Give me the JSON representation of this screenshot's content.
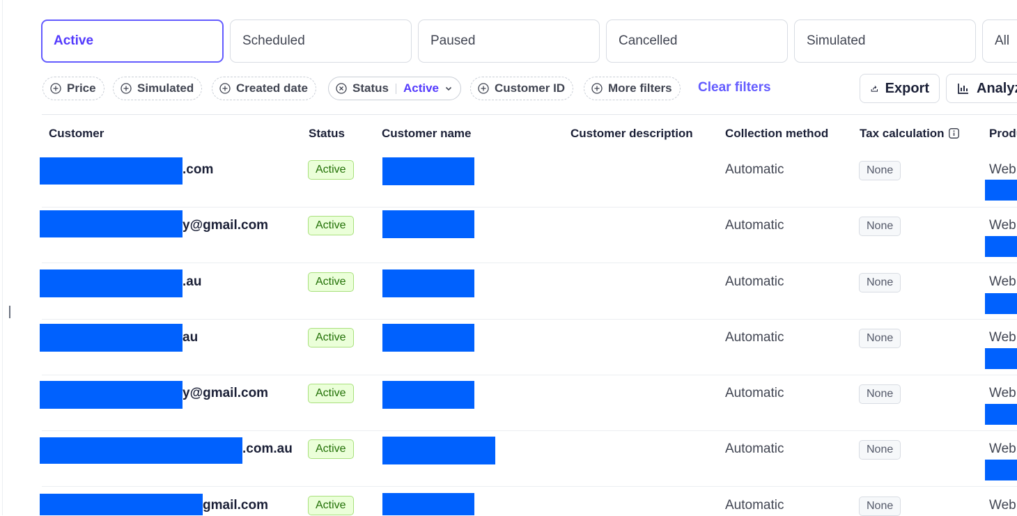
{
  "tabs": [
    {
      "label": "Active",
      "selected": true
    },
    {
      "label": "Scheduled",
      "selected": false
    },
    {
      "label": "Paused",
      "selected": false
    },
    {
      "label": "Cancelled",
      "selected": false
    },
    {
      "label": "Simulated",
      "selected": false
    },
    {
      "label": "All",
      "selected": false
    }
  ],
  "filters": {
    "price": "Price",
    "simulated": "Simulated",
    "created_date": "Created date",
    "status_label": "Status",
    "status_value": "Active",
    "customer_id": "Customer ID",
    "more": "More filters",
    "clear": "Clear filters"
  },
  "toolbar": {
    "export": "Export",
    "analyze": "Analyze"
  },
  "columns": {
    "customer": "Customer",
    "status": "Status",
    "customer_name": "Customer name",
    "customer_description": "Customer description",
    "collection_method": "Collection method",
    "tax_calculation": "Tax calculation",
    "product": "Product"
  },
  "rows": [
    {
      "customer_visible": ".com",
      "status": "Active",
      "collection": "Automatic",
      "tax": "None",
      "product": "Web"
    },
    {
      "customer_visible": "y@gmail.com",
      "status": "Active",
      "collection": "Automatic",
      "tax": "None",
      "product": "Web"
    },
    {
      "customer_visible": ".au",
      "status": "Active",
      "collection": "Automatic",
      "tax": "None",
      "product": "Web"
    },
    {
      "customer_visible": "au",
      "status": "Active",
      "collection": "Automatic",
      "tax": "None",
      "product": "Web"
    },
    {
      "customer_visible": "y@gmail.com",
      "status": "Active",
      "collection": "Automatic",
      "tax": "None",
      "product": "Web"
    },
    {
      "customer_visible": ".com.au",
      "status": "Active",
      "collection": "Automatic",
      "tax": "None",
      "product": "Web"
    },
    {
      "customer_visible": "gmail.com",
      "status": "Active",
      "collection": "Automatic",
      "tax": "None",
      "product": "Web"
    }
  ],
  "colors": {
    "accent": "#635bff",
    "redaction": "#0061fe",
    "active_badge_bg": "#ebffd9",
    "active_badge_text": "#217005"
  },
  "icons": [
    "plus-circle-icon",
    "x-circle-icon",
    "chevron-down-icon",
    "export-icon",
    "bar-chart-icon",
    "info-icon"
  ]
}
